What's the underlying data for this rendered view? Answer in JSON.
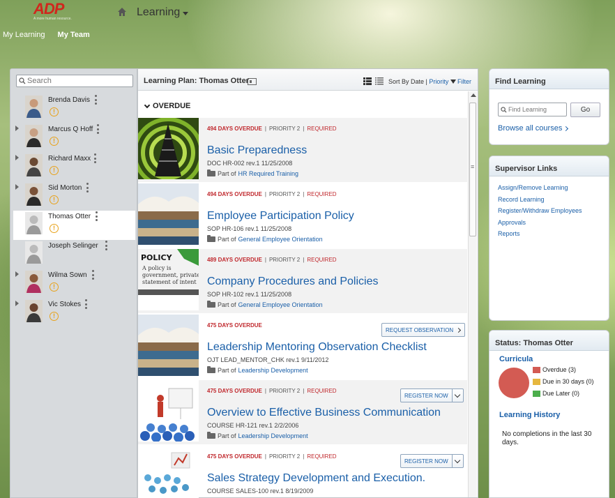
{
  "header": {
    "logo_text": "ADP",
    "logo_tagline": "A more human resource.",
    "app_menu_label": "Learning",
    "nav": [
      {
        "label": "My Learning",
        "active": false
      },
      {
        "label": "My Team",
        "active": true
      }
    ]
  },
  "team": {
    "search_placeholder": "Search",
    "members": [
      {
        "name": "Brenda Davis",
        "expandable": false,
        "selected": false,
        "has_alert": true
      },
      {
        "name": "Marcus Q Hoff",
        "expandable": true,
        "selected": false,
        "has_alert": true
      },
      {
        "name": "Richard Maxx",
        "expandable": true,
        "selected": false,
        "has_alert": true
      },
      {
        "name": "Sid Morton",
        "expandable": true,
        "selected": false,
        "has_alert": true
      },
      {
        "name": "Thomas Otter",
        "expandable": false,
        "selected": true,
        "has_alert": true
      },
      {
        "name": "Joseph Selinger",
        "expandable": false,
        "selected": false,
        "has_alert": false
      },
      {
        "name": "Wilma Sown",
        "expandable": true,
        "selected": false,
        "has_alert": true
      },
      {
        "name": "Vic Stokes",
        "expandable": true,
        "selected": false,
        "has_alert": true
      }
    ],
    "alert_glyph": "!"
  },
  "plan": {
    "title": "Learning Plan: Thomas Otter",
    "sort_prefix": "Sort By Date |",
    "sort_priority": "Priority",
    "filter_label": "Filter",
    "section_label": "OVERDUE",
    "part_of_prefix": "Part of",
    "courses": [
      {
        "overdue": "494 DAYS OVERDUE",
        "priority": "PRIORITY 2",
        "required": "REQUIRED",
        "title": "Basic Preparedness",
        "code": "DOC HR-002 rev.1 11/25/2008",
        "part_of": "HR Required Training",
        "action": "",
        "thumb": "pyramid"
      },
      {
        "overdue": "494 DAYS OVERDUE",
        "priority": "PRIORITY 2",
        "required": "REQUIRED",
        "title": "Employee Participation Policy",
        "code": "SOP HR-106 rev.1 11/25/2008",
        "part_of": "General Employee Orientation",
        "action": "",
        "thumb": "books"
      },
      {
        "overdue": "489 DAYS OVERDUE",
        "priority": "PRIORITY 2",
        "required": "REQUIRED",
        "title": "Company Procedures and Policies",
        "code": "SOP HR-102 rev.1 11/25/2008",
        "part_of": "General Employee Orientation",
        "action": "",
        "thumb": "policy"
      },
      {
        "overdue": "475 DAYS OVERDUE",
        "priority": "",
        "required": "",
        "title": "Leadership Mentoring Observation Checklist",
        "code": "OJT LEAD_MENTOR_CHK rev.1 9/11/2012",
        "part_of": "Leadership Development",
        "action": "REQUEST OBSERVATION",
        "thumb": "books"
      },
      {
        "overdue": "475 DAYS OVERDUE",
        "priority": "PRIORITY 2",
        "required": "REQUIRED",
        "title": "Overview to Effective Business Communication",
        "code": "COURSE HR-121 rev.1 2/2/2006",
        "part_of": "Leadership Development",
        "action": "REGISTER NOW",
        "thumb": "presenter"
      },
      {
        "overdue": "475 DAYS OVERDUE",
        "priority": "PRIORITY 2",
        "required": "REQUIRED",
        "title": "Sales Strategy Development and Execution.",
        "code": "COURSE SALES-100 rev.1 8/19/2009",
        "part_of": "",
        "action": "REGISTER NOW",
        "thumb": "figures"
      }
    ]
  },
  "find_learning": {
    "title": "Find Learning",
    "search_placeholder": "Find Learning",
    "go_label": "Go",
    "browse_label": "Browse all courses"
  },
  "supervisor": {
    "title": "Supervisor Links",
    "links": [
      "Assign/Remove Learning",
      "Record Learning",
      "Register/Withdraw Employees",
      "Approvals",
      "Reports"
    ]
  },
  "status": {
    "title": "Status: Thomas Otter",
    "curricula_label": "Curricula",
    "legend": [
      {
        "label": "Overdue (3)",
        "color": "#d35b53"
      },
      {
        "label": "Due in 30 days (0)",
        "color": "#e6b73e"
      },
      {
        "label": "Due Later (0)",
        "color": "#4cae4c"
      }
    ],
    "history_label": "Learning History",
    "history_text": "No completions in the last 30 days."
  },
  "colors": {
    "accent": "#1a5fa8",
    "overdue_red": "#c0282d",
    "alert_orange": "#e8a21a"
  }
}
